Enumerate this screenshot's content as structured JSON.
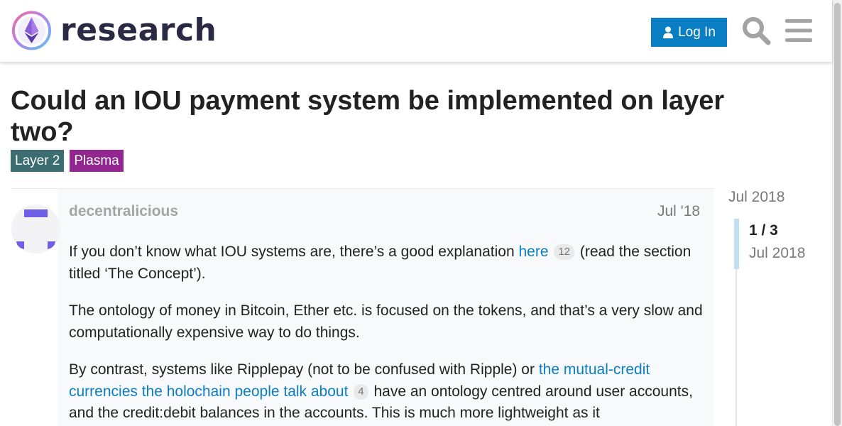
{
  "header": {
    "logo_text": "research",
    "login_label": "Log In",
    "search_icon": "search-icon",
    "menu_icon": "hamburger-menu-icon",
    "accent_color": "#0a7ec2"
  },
  "topic": {
    "title": "Could an IOU payment system be implemented on layer two?",
    "tags": [
      {
        "label": "Layer 2",
        "color": "#3c6e71"
      },
      {
        "label": "Plasma",
        "color": "#92278f"
      }
    ]
  },
  "post": {
    "username": "decentralicious",
    "date": "Jul '18",
    "p1": {
      "before": "If you don’t know what IOU systems are, there’s a good explanation ",
      "link": "here",
      "clicks": "12",
      "after": " (read the section titled ‘The Concept’)."
    },
    "p2": "The ontology of money in Bitcoin, Ether etc. is focused on the tokens, and that’s a very slow and computationally expensive way to do things.",
    "p3": {
      "before": "By contrast, systems like Ripplepay (not to be confused with Ripple) or ",
      "link": "the mutual-credit currencies the holochain people talk about",
      "clicks": "4",
      "after": " have an ontology centred around user accounts, and the credit:debit balances in the accounts. This is much more lightweight as it"
    }
  },
  "timeline": {
    "start_date": "Jul 2018",
    "position": "1 / 3",
    "current_date": "Jul 2018"
  }
}
